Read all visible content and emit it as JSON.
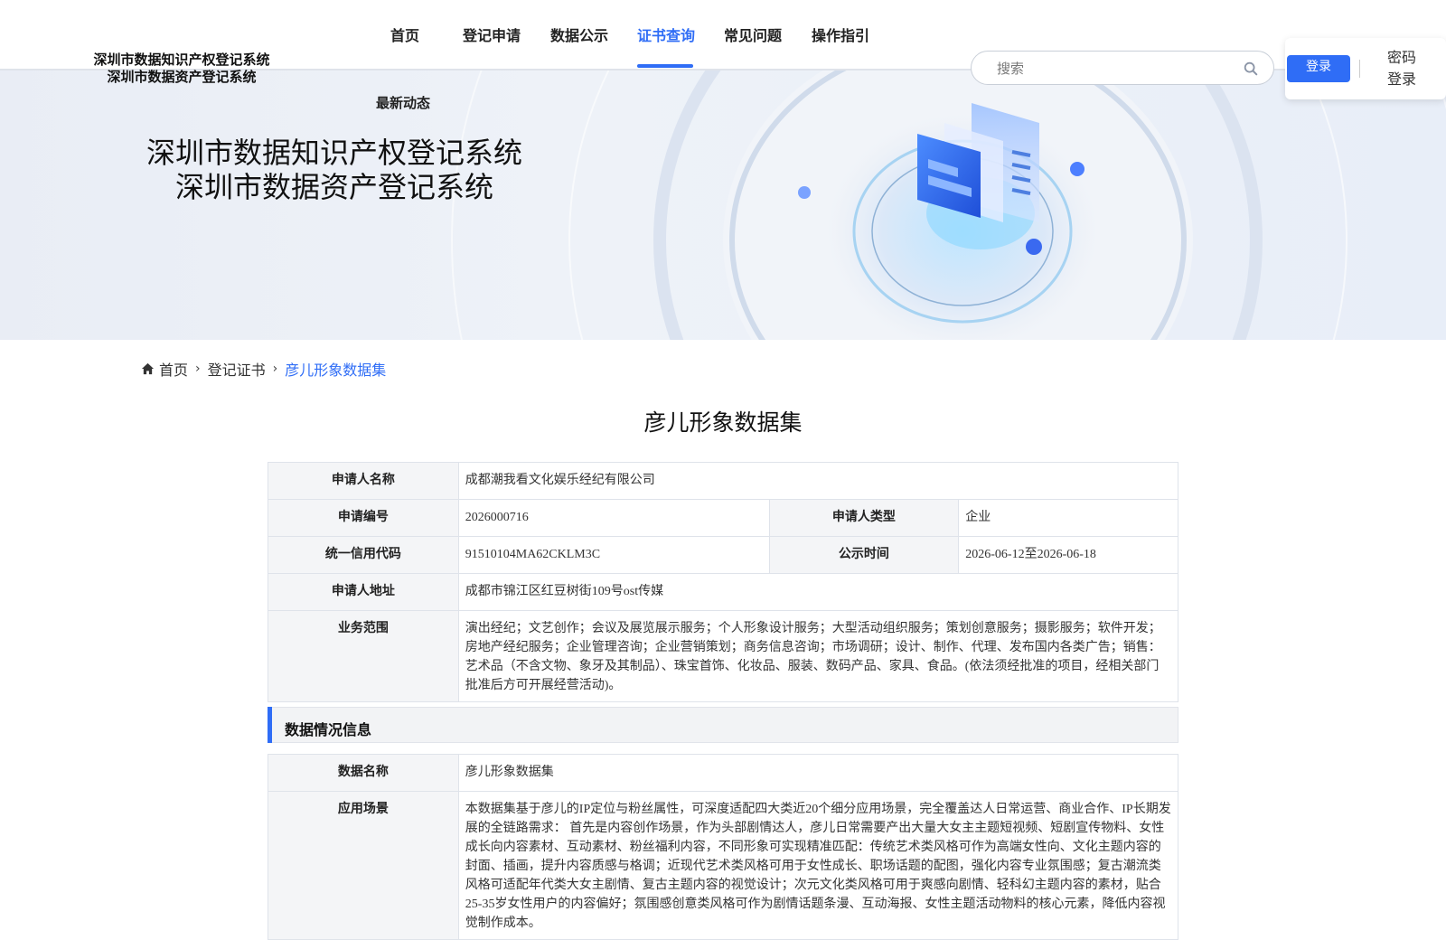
{
  "site": {
    "title_line1": "深圳市数据知识产权登记系统",
    "title_line2": "深圳市数据资产登记系统"
  },
  "nav": {
    "items": [
      "首页",
      "登记申请",
      "数据公示",
      "证书查询",
      "常见问题",
      "操作指引"
    ],
    "active": "证书查询",
    "sub_item": "最新动态"
  },
  "search": {
    "placeholder": "搜索"
  },
  "login": {
    "login_label": "登录",
    "password_login": "密码登录"
  },
  "banner": {
    "title_line1": "深圳市数据知识产权登记系统",
    "title_line2": "深圳市数据资产登记系统"
  },
  "breadcrumb": {
    "home": "首页",
    "level2": "登记证书",
    "current": "彦儿形象数据集"
  },
  "page_title": "彦儿形象数据集",
  "applicant": {
    "name_label": "申请人名称",
    "name": "成都潮我看文化娱乐经纪有限公司",
    "number_label": "申请编号",
    "number": "2026000716",
    "type_label": "申请人类型",
    "type": "企业",
    "credit_label": "统一信用代码",
    "credit": "91510104MA62CKLM3C",
    "publicity_label": "公示时间",
    "publicity": "2026-06-12至2026-06-18",
    "address_label": "申请人地址",
    "address": "成都市锦江区红豆树街109号ost传媒",
    "scope_label": "业务范围",
    "scope": "演出经纪；文艺创作；会议及展览展示服务；个人形象设计服务；大型活动组织服务；策划创意服务；摄影服务；软件开发；房地产经纪服务；企业管理咨询；企业营销策划；商务信息咨询；市场调研；设计、制作、代理、发布国内各类广告；销售：艺术品（不含文物、象牙及其制品）、珠宝首饰、化妆品、服装、数码产品、家具、食品。(依法须经批准的项目，经相关部门批准后方可开展经营活动)。"
  },
  "data_section": {
    "header": "数据情况信息",
    "name_label": "数据名称",
    "name": "彦儿形象数据集",
    "scenario_label": "应用场景",
    "scenario": "本数据集基于彦儿的IP定位与粉丝属性，可深度适配四大类近20个细分应用场景，完全覆盖达人日常运营、商业合作、IP长期发展的全链路需求： 首先是内容创作场景，作为头部剧情达人，彦儿日常需要产出大量大女主主题短视频、短剧宣传物料、女性成长向内容素材、互动素材、粉丝福利内容，不同形象可实现精准匹配：传统艺术类风格可作为高端女性向、文化主题内容的封面、插画，提升内容质感与格调；近现代艺术类风格可用于女性成长、职场话题的配图，强化内容专业氛围感；复古潮流类风格可适配年代类大女主剧情、复古主题内容的视觉设计；次元文化类风格可用于爽感向剧情、轻科幻主题内容的素材，贴合25-35岁女性用户的内容偏好；氛围感创意类风格可作为剧情话题条漫、互动海报、女性主题活动物料的核心元素，降低内容视觉制作成本。"
  },
  "colors": {
    "accent": "#2f6df6",
    "label_bg": "#f4f5f7",
    "border": "#dfe3ea"
  }
}
